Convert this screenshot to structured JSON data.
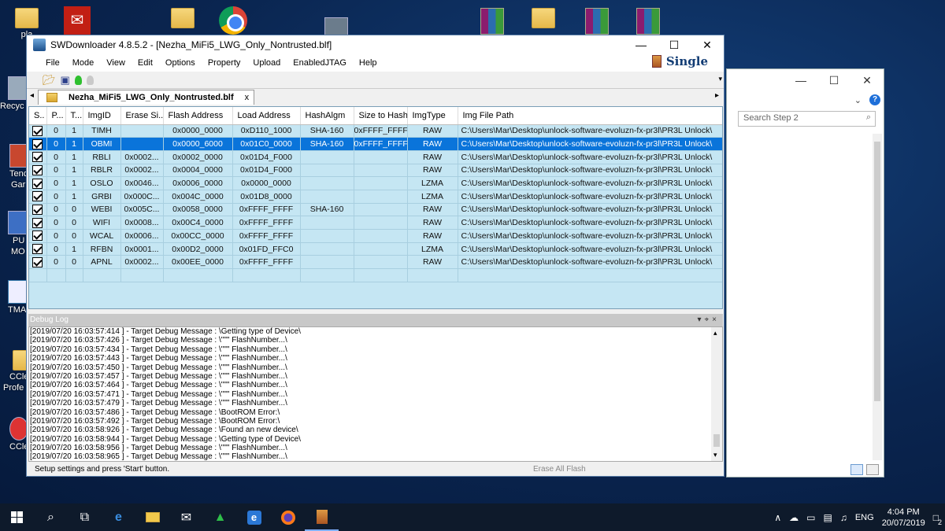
{
  "desktop": {
    "icons": [
      {
        "name": "desktop-folder-pla",
        "label": "pla",
        "kind": "folder"
      },
      {
        "name": "desktop-adobe-pdf",
        "label": "",
        "kind": "pdf"
      },
      {
        "name": "desktop-folder-2",
        "label": "",
        "kind": "folder"
      },
      {
        "name": "desktop-chrome",
        "label": "",
        "kind": "chrome"
      },
      {
        "name": "desktop-recycle",
        "label": "Recyc",
        "kind": "recycle"
      },
      {
        "name": "desktop-tenc",
        "label": "Tenc",
        "kind": "app"
      },
      {
        "name": "desktop-pu",
        "label": "PU",
        "kind": "app"
      },
      {
        "name": "desktop-tma",
        "label": "TMA",
        "kind": "app"
      },
      {
        "name": "desktop-ccle",
        "label": "CCle",
        "kind": "app"
      },
      {
        "name": "desktop-ccle2",
        "label": "CCle",
        "kind": "app"
      }
    ],
    "extra_labels": {
      "gar": "Gar",
      "mo": "MO",
      "profe": "Profe"
    }
  },
  "back_window": {
    "search_placeholder": "Search Step 2",
    "minimize": "—",
    "maximize": "☐",
    "close": "✕",
    "help": "?"
  },
  "main_window": {
    "title": "SWDownloader 4.8.5.2 - [Nezha_MiFi5_LWG_Only_Nontrusted.blf]",
    "controls": {
      "minimize": "—",
      "maximize": "☐",
      "close": "✕"
    },
    "menu": [
      "File",
      "Mode",
      "View",
      "Edit",
      "Options",
      "Property",
      "Upload",
      "EnabledJTAG",
      "Help"
    ],
    "mode_label": "Single",
    "tab": {
      "label": "Nezha_MiFi5_LWG_Only_Nontrusted.blf",
      "close": "x"
    },
    "table": {
      "headers": [
        "S..",
        "P...",
        "T...",
        "ImgID",
        "Erase Si...",
        "Flash Address",
        "Load Address",
        "HashAlgm",
        "Size to Hash",
        "ImgType",
        "Img File Path"
      ],
      "selected_row": 1,
      "rows": [
        [
          "",
          "0",
          "1",
          "TIMH",
          "",
          "0x0000_0000",
          "0xD110_1000",
          "SHA-160",
          "0xFFFF_FFFF",
          "RAW",
          "C:\\Users\\Mar\\Desktop\\unlock-software-evoluzn-fx-pr3l\\PR3L Unlock\\"
        ],
        [
          "",
          "0",
          "1",
          "OBMI",
          "",
          "0x0000_6000",
          "0x01C0_0000",
          "SHA-160",
          "0xFFFF_FFFF",
          "RAW",
          "C:\\Users\\Mar\\Desktop\\unlock-software-evoluzn-fx-pr3l\\PR3L Unlock\\"
        ],
        [
          "",
          "0",
          "1",
          "RBLI",
          "0x0002...",
          "0x0002_0000",
          "0x01D4_F000",
          "",
          "",
          "RAW",
          "C:\\Users\\Mar\\Desktop\\unlock-software-evoluzn-fx-pr3l\\PR3L Unlock\\"
        ],
        [
          "",
          "0",
          "1",
          "RBLR",
          "0x0002...",
          "0x0004_0000",
          "0x01D4_F000",
          "",
          "",
          "RAW",
          "C:\\Users\\Mar\\Desktop\\unlock-software-evoluzn-fx-pr3l\\PR3L Unlock\\"
        ],
        [
          "",
          "0",
          "1",
          "OSLO",
          "0x0046...",
          "0x0006_0000",
          "0x0000_0000",
          "",
          "",
          "LZMA",
          "C:\\Users\\Mar\\Desktop\\unlock-software-evoluzn-fx-pr3l\\PR3L Unlock\\"
        ],
        [
          "",
          "0",
          "1",
          "GRBI",
          "0x000C...",
          "0x004C_0000",
          "0x01D8_0000",
          "",
          "",
          "LZMA",
          "C:\\Users\\Mar\\Desktop\\unlock-software-evoluzn-fx-pr3l\\PR3L Unlock\\"
        ],
        [
          "",
          "0",
          "0",
          "WEBI",
          "0x005C...",
          "0x0058_0000",
          "0xFFFF_FFFF",
          "SHA-160",
          "",
          "RAW",
          "C:\\Users\\Mar\\Desktop\\unlock-software-evoluzn-fx-pr3l\\PR3L Unlock\\"
        ],
        [
          "",
          "0",
          "0",
          "WIFI",
          "0x0008...",
          "0x00C4_0000",
          "0xFFFF_FFFF",
          "",
          "",
          "RAW",
          "C:\\Users\\Mar\\Desktop\\unlock-software-evoluzn-fx-pr3l\\PR3L Unlock\\"
        ],
        [
          "",
          "0",
          "0",
          "WCAL",
          "0x0006...",
          "0x00CC_0000",
          "0xFFFF_FFFF",
          "",
          "",
          "RAW",
          "C:\\Users\\Mar\\Desktop\\unlock-software-evoluzn-fx-pr3l\\PR3L Unlock\\"
        ],
        [
          "",
          "0",
          "1",
          "RFBN",
          "0x0001...",
          "0x00D2_0000",
          "0x01FD_FFC0",
          "",
          "",
          "LZMA",
          "C:\\Users\\Mar\\Desktop\\unlock-software-evoluzn-fx-pr3l\\PR3L Unlock\\"
        ],
        [
          "",
          "0",
          "0",
          "APNL",
          "0x0002...",
          "0x00EE_0000",
          "0xFFFF_FFFF",
          "",
          "",
          "RAW",
          "C:\\Users\\Mar\\Desktop\\unlock-software-evoluzn-fx-pr3l\\PR3L Unlock\\"
        ]
      ]
    },
    "debug_log": {
      "title": "Debug Log",
      "lines": [
        "[2019/07/20 16:03:57:414 ] - Target Debug Message : \\Getting type of Device\\",
        "[2019/07/20 16:03:57:426 ] - Target Debug Message : \\\"\"\" FlashNumber...\\",
        "[2019/07/20 16:03:57:434 ] - Target Debug Message : \\\"\"\" FlashNumber...\\",
        "[2019/07/20 16:03:57:443 ] - Target Debug Message : \\\"\"\" FlashNumber...\\",
        "[2019/07/20 16:03:57:450 ] - Target Debug Message : \\\"\"\" FlashNumber...\\",
        "[2019/07/20 16:03:57:457 ] - Target Debug Message : \\\"\"\" FlashNumber...\\",
        "[2019/07/20 16:03:57:464 ] - Target Debug Message : \\\"\"\" FlashNumber...\\",
        "[2019/07/20 16:03:57:471 ] - Target Debug Message : \\\"\"\" FlashNumber...\\",
        "[2019/07/20 16:03:57:479 ] - Target Debug Message : \\\"\"\" FlashNumber...\\",
        "[2019/07/20 16:03:57:486 ] - Target Debug Message : \\BootROM Error:\\",
        "[2019/07/20 16:03:57:492 ] - Target Debug Message : \\BootROM Error:\\",
        "[2019/07/20 16:03:58:926 ] - Target Debug Message : \\Found an new device\\",
        "[2019/07/20 16:03:58:944 ] - Target Debug Message : \\Getting type of Device\\",
        "[2019/07/20 16:03:58:956 ] - Target Debug Message : \\\"\"\" FlashNumber...\\",
        "[2019/07/20 16:03:58:965 ] - Target Debug Message : \\\"\"\" FlashNumber...\\"
      ]
    },
    "status": {
      "left": "Setup settings and press 'Start' button.",
      "right": "Erase All Flash"
    }
  },
  "taskbar": {
    "tray": {
      "language": "ENG",
      "time": "4:04 PM",
      "date": "20/07/2019",
      "notifications": "2"
    }
  }
}
